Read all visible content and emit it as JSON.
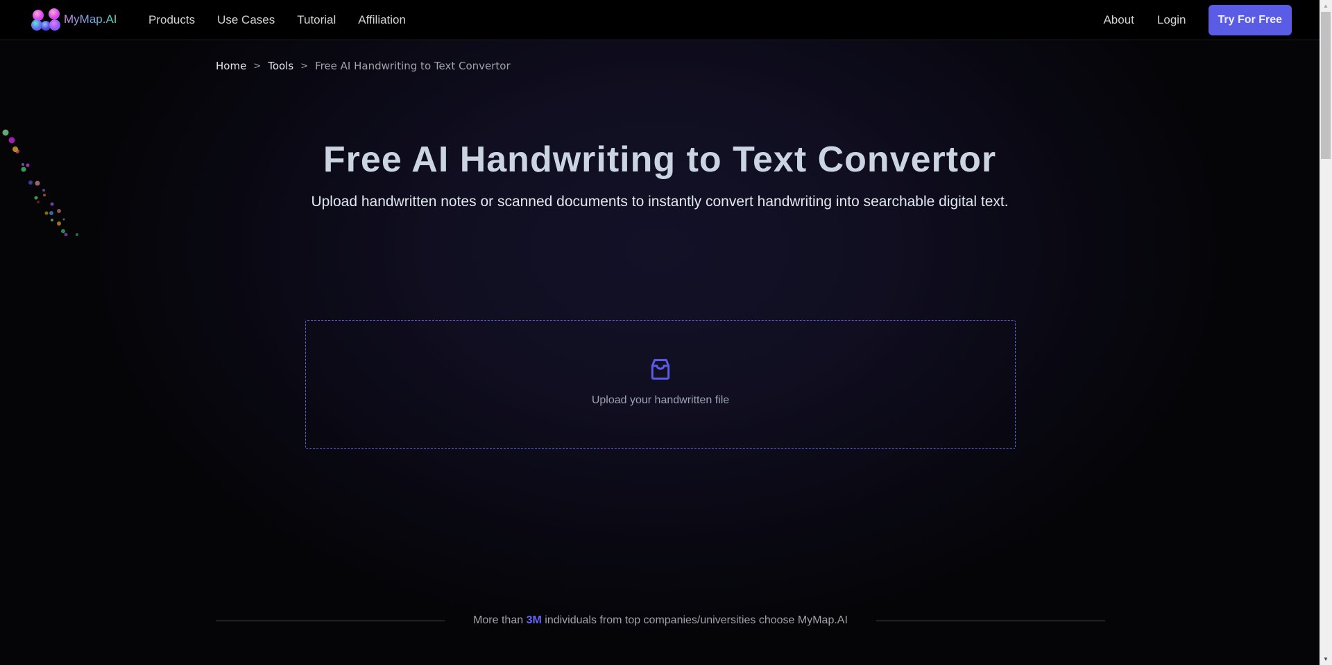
{
  "brand": {
    "name": "MyMap.AI",
    "accent": "#5b5ce6"
  },
  "nav": {
    "links": [
      "Products",
      "Use Cases",
      "Tutorial",
      "Affiliation"
    ],
    "about": "About",
    "login": "Login",
    "cta": "Try For Free"
  },
  "breadcrumb": {
    "home": "Home",
    "tools": "Tools",
    "separator": ">",
    "current": "Free AI Handwriting to Text Convertor"
  },
  "hero": {
    "title": "Free AI Handwriting to Text Convertor",
    "subtitle": "Upload handwritten notes or scanned documents to instantly convert handwriting into searchable digital text."
  },
  "upload": {
    "icon": "inbox-icon",
    "label": "Upload your handwritten file"
  },
  "social_proof": {
    "prefix": "More than",
    "highlight": "3M",
    "suffix": "individuals from top companies/universities choose MyMap.AI"
  }
}
